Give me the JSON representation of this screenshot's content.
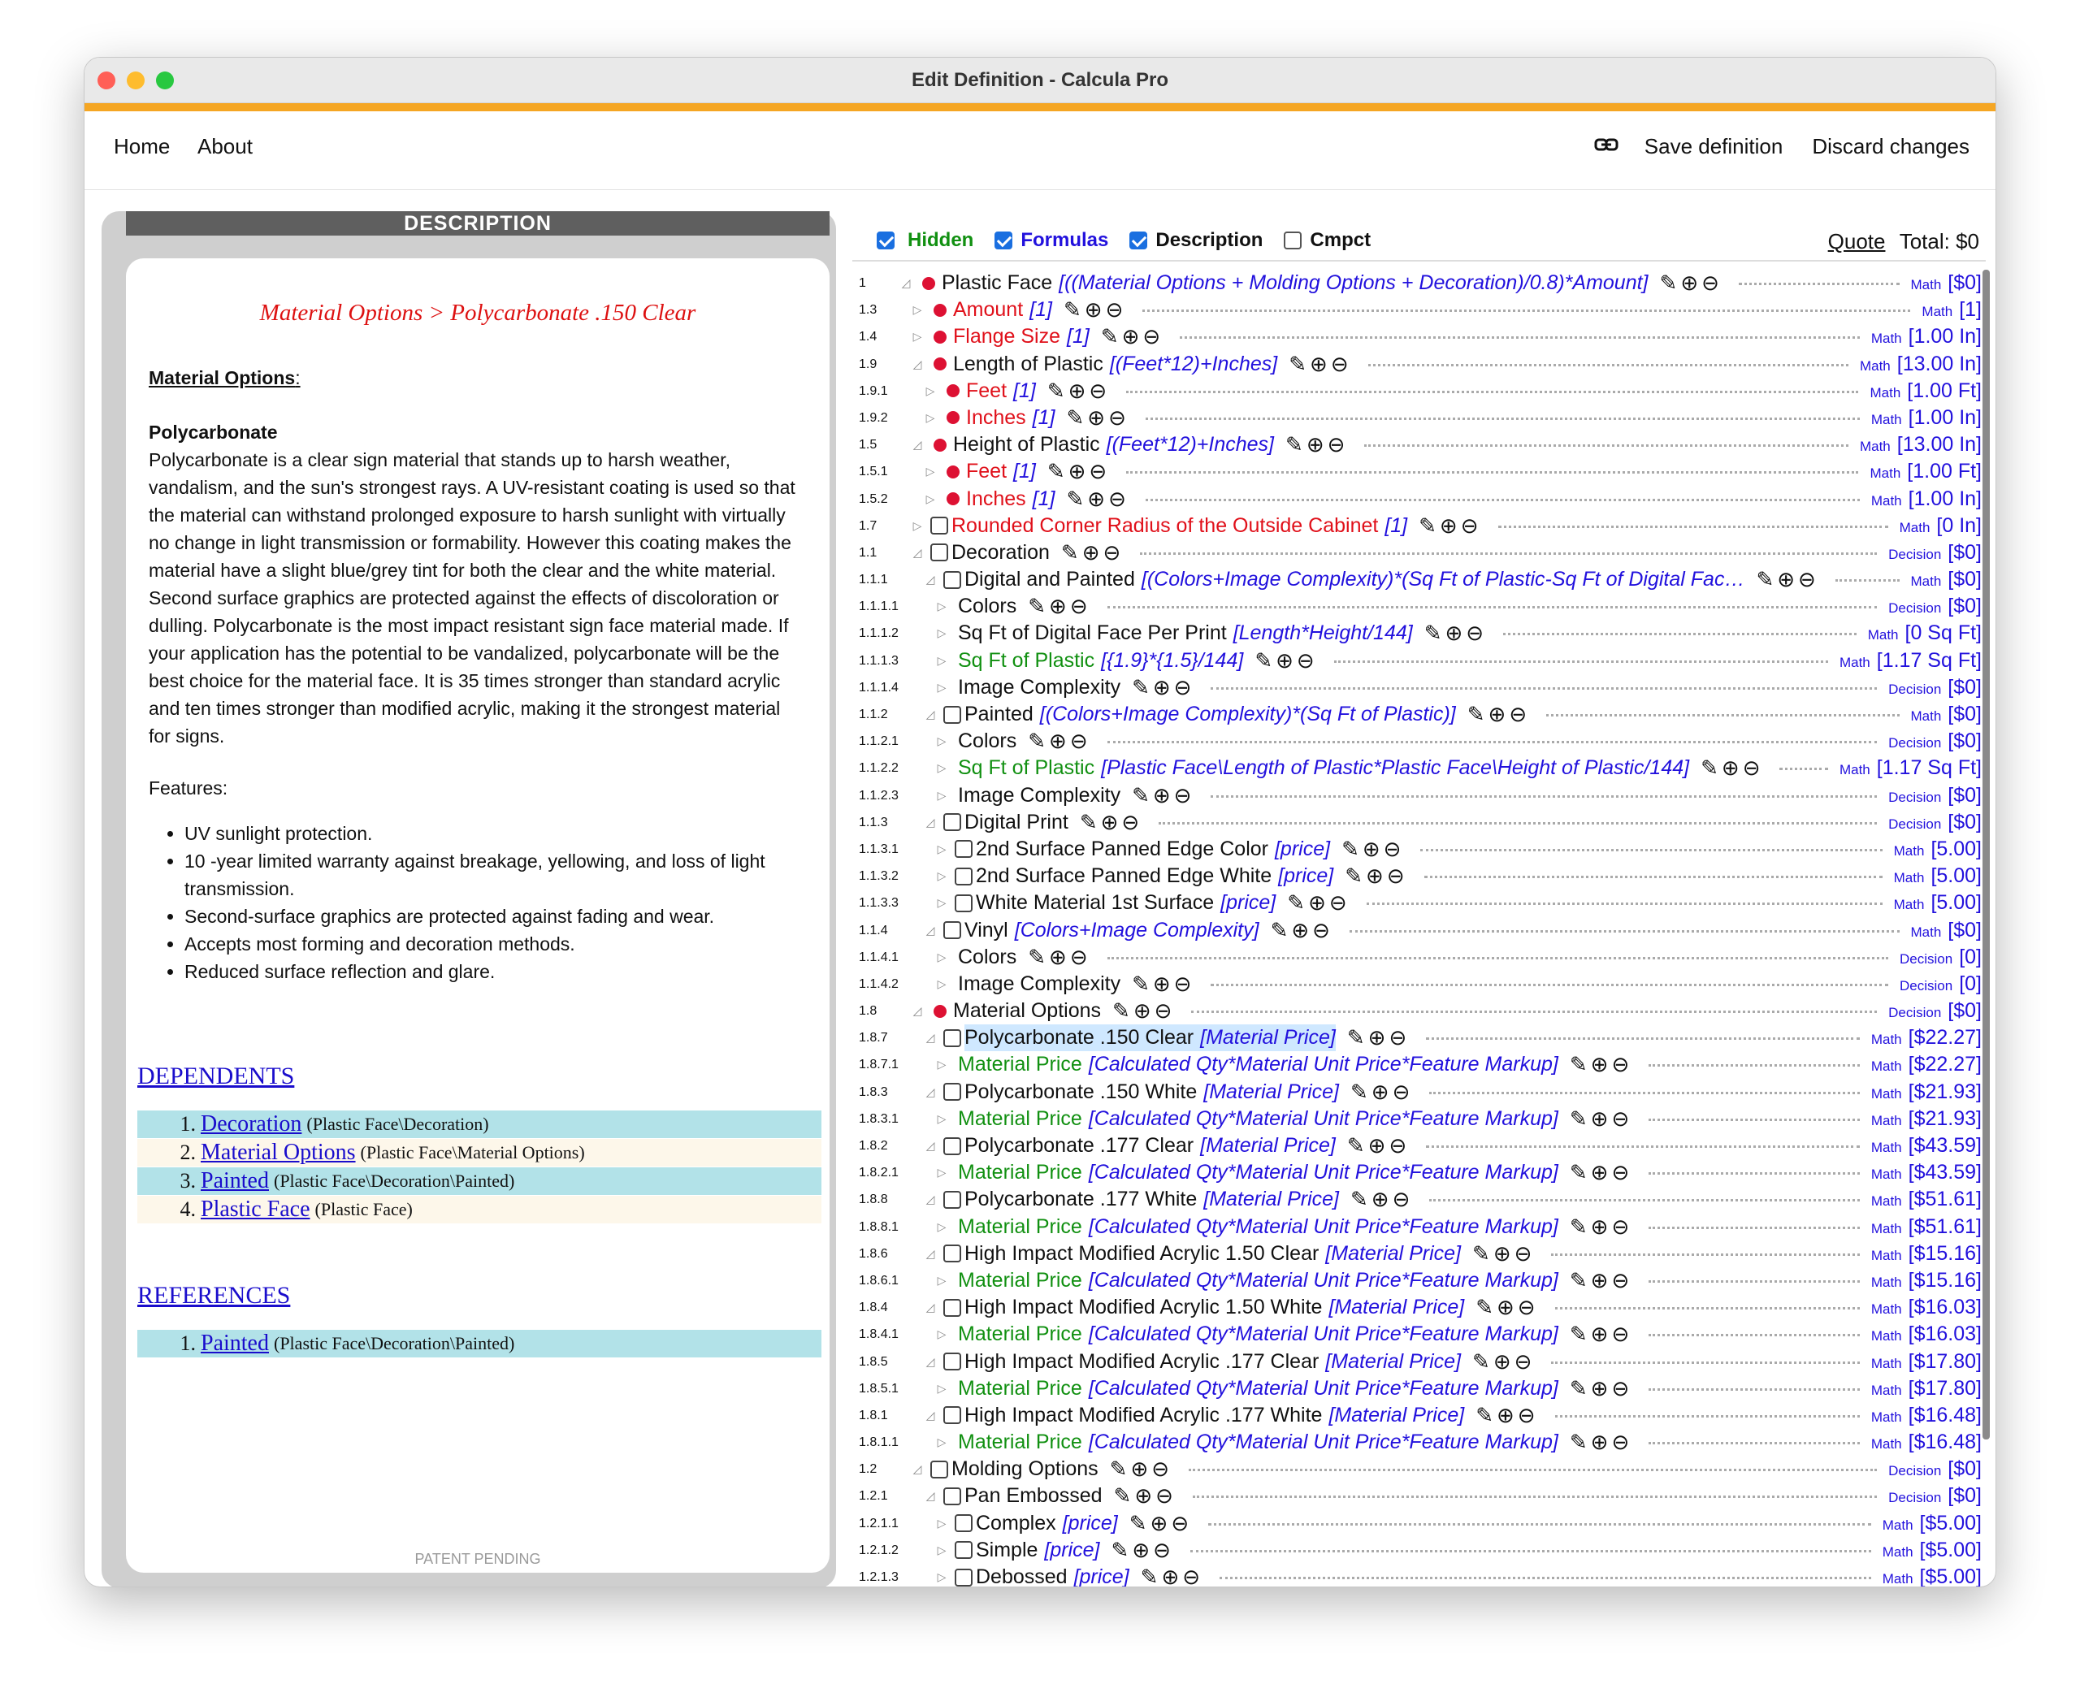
{
  "window": {
    "title": "Edit Definition - Calcula Pro"
  },
  "nav": {
    "home": "Home",
    "about": "About",
    "save": "Save definition",
    "discard": "Discard changes"
  },
  "description": {
    "header": "DESCRIPTION",
    "breadcrumb": "Material Options > Polycarbonate .150 Clear",
    "section_title": "Material Options",
    "product_name": "Polycarbonate",
    "paragraph": "Polycarbonate  is a clear sign material that stands up to harsh weather, vandalism, and the sun's strongest rays. A UV-resistant coating is used so that the material can withstand prolonged exposure to harsh sunlight with virtually no change in light transmission or formability. However this coating makes the material have a slight blue/grey tint for both the clear and the white material. Second surface graphics are protected against the effects of discoloration or dulling. Polycarbonate is the most impact resistant sign face material made. If your application has the potential to be vandalized, polycarbonate will be the best choice for the material face. It is 35 times stronger than standard acrylic and ten times stronger than modified acrylic, making it the strongest material for signs.",
    "features_label": "Features:",
    "features": [
      "UV sunlight protection.",
      "10 -year limited warranty against breakage, yellowing, and loss of light transmission.",
      "Second-surface graphics are protected against fading and wear.",
      "Accepts most forming and decoration methods.",
      "Reduced  surface reflection and glare."
    ],
    "patent": "PATENT PENDING"
  },
  "dependents": {
    "title": "DEPENDENTS",
    "items": [
      {
        "n": "1.",
        "link": "Decoration",
        "path": "(Plastic Face\\Decoration)",
        "bg": "#b2e2e8"
      },
      {
        "n": "2.",
        "link": "Material Options",
        "path": "(Plastic Face\\Material Options)",
        "bg": "#fdf7ea"
      },
      {
        "n": "3.",
        "link": "Painted",
        "path": "(Plastic Face\\Decoration\\Painted)",
        "bg": "#b2e2e8"
      },
      {
        "n": "4.",
        "link": "Plastic Face",
        "path": "(Plastic Face)",
        "bg": "#fdf7ea"
      }
    ]
  },
  "references": {
    "title": "REFERENCES",
    "items": [
      {
        "n": "1.",
        "link": "Painted",
        "path": "(Plastic Face\\Decoration\\Painted)",
        "bg": "#b2e2e8"
      }
    ]
  },
  "toolbar": {
    "hidden": "Hidden",
    "formulas": "Formulas",
    "description": "Description",
    "compact": "Cmpct",
    "quote": "Quote",
    "total": "Total: $0"
  },
  "colors": {
    "accent": "#f5a623",
    "hidden": "#119011",
    "formulas": "#2211dd",
    "red": "#e0101a",
    "green": "#119011",
    "blue": "#2211dd"
  },
  "icons": {
    "edit": "pencil-icon",
    "add": "plus-circle-icon",
    "remove": "minus-circle-icon",
    "link": "link-icon",
    "expand": "triangle-right-icon",
    "collapse": "triangle-down-icon"
  },
  "tree": [
    {
      "id": "1",
      "lvl": 0,
      "open": true,
      "mark": "bullet",
      "color": "black",
      "name": "Plastic Face",
      "fx": "[((Material Options + Molding Options + Decoration)/0.8)*Amount]",
      "type": "Math",
      "val": "[$0]"
    },
    {
      "id": "1.3",
      "lvl": 1,
      "open": false,
      "mark": "bullet",
      "color": "red",
      "name": "Amount",
      "fx": "[1]",
      "type": "Math",
      "val": "[1]"
    },
    {
      "id": "1.4",
      "lvl": 1,
      "open": false,
      "mark": "bullet",
      "color": "red",
      "name": "Flange Size",
      "fx": "[1]",
      "type": "Math",
      "val": "[1.00 In]"
    },
    {
      "id": "1.9",
      "lvl": 1,
      "open": true,
      "mark": "bullet",
      "color": "black",
      "name": "Length of Plastic",
      "fx": "[(Feet*12)+Inches]",
      "type": "Math",
      "val": "[13.00 In]"
    },
    {
      "id": "1.9.1",
      "lvl": 2,
      "open": false,
      "mark": "bullet",
      "color": "red",
      "name": "Feet",
      "fx": "[1]",
      "type": "Math",
      "val": "[1.00 Ft]"
    },
    {
      "id": "1.9.2",
      "lvl": 2,
      "open": false,
      "mark": "bullet",
      "color": "red",
      "name": "Inches",
      "fx": "[1]",
      "type": "Math",
      "val": "[1.00 In]"
    },
    {
      "id": "1.5",
      "lvl": 1,
      "open": true,
      "mark": "bullet",
      "color": "black",
      "name": "Height of Plastic",
      "fx": "[(Feet*12)+Inches]",
      "type": "Math",
      "val": "[13.00 In]"
    },
    {
      "id": "1.5.1",
      "lvl": 2,
      "open": false,
      "mark": "bullet",
      "color": "red",
      "name": "Feet",
      "fx": "[1]",
      "type": "Math",
      "val": "[1.00 Ft]"
    },
    {
      "id": "1.5.2",
      "lvl": 2,
      "open": false,
      "mark": "bullet",
      "color": "red",
      "name": "Inches",
      "fx": "[1]",
      "type": "Math",
      "val": "[1.00 In]"
    },
    {
      "id": "1.7",
      "lvl": 1,
      "open": false,
      "mark": "check",
      "color": "red",
      "name": "Rounded Corner Radius of the Outside Cabinet",
      "fx": "[1]",
      "type": "Math",
      "val": "[0 In]"
    },
    {
      "id": "1.1",
      "lvl": 1,
      "open": true,
      "mark": "check",
      "color": "black",
      "name": "Decoration",
      "fx": "",
      "type": "Decision",
      "val": "[$0]"
    },
    {
      "id": "1.1.1",
      "lvl": 2,
      "open": true,
      "mark": "check",
      "color": "black",
      "name": "Digital and Painted",
      "fx": "[(Colors+Image Complexity)*(Sq Ft of Plastic-Sq Ft of Digital Fac…",
      "type": "Math",
      "val": "[$0]"
    },
    {
      "id": "1.1.1.1",
      "lvl": 3,
      "open": false,
      "mark": "none",
      "color": "black",
      "name": "Colors",
      "fx": "",
      "type": "Decision",
      "val": "[$0]"
    },
    {
      "id": "1.1.1.2",
      "lvl": 3,
      "open": false,
      "mark": "none",
      "color": "black",
      "name": "Sq Ft of Digital Face Per Print",
      "fx": "[Length*Height/144]",
      "type": "Math",
      "val": "[0 Sq Ft]"
    },
    {
      "id": "1.1.1.3",
      "lvl": 3,
      "open": false,
      "mark": "none",
      "color": "green",
      "name": "Sq Ft of Plastic",
      "fx": "[{1.9}*{1.5}/144]",
      "type": "Math",
      "val": "[1.17 Sq Ft]"
    },
    {
      "id": "1.1.1.4",
      "lvl": 3,
      "open": false,
      "mark": "none",
      "color": "black",
      "name": "Image Complexity",
      "fx": "",
      "type": "Decision",
      "val": "[$0]"
    },
    {
      "id": "1.1.2",
      "lvl": 2,
      "open": true,
      "mark": "check",
      "color": "black",
      "name": "Painted",
      "fx": "[(Colors+Image Complexity)*(Sq Ft of Plastic)]",
      "type": "Math",
      "val": "[$0]"
    },
    {
      "id": "1.1.2.1",
      "lvl": 3,
      "open": false,
      "mark": "none",
      "color": "black",
      "name": "Colors",
      "fx": "",
      "type": "Decision",
      "val": "[$0]"
    },
    {
      "id": "1.1.2.2",
      "lvl": 3,
      "open": false,
      "mark": "none",
      "color": "green",
      "name": "Sq Ft of Plastic",
      "fx": "[Plastic Face\\Length of Plastic*Plastic Face\\Height of Plastic/144]",
      "type": "Math",
      "val": "[1.17 Sq Ft]"
    },
    {
      "id": "1.1.2.3",
      "lvl": 3,
      "open": false,
      "mark": "none",
      "color": "black",
      "name": "Image Complexity",
      "fx": "",
      "type": "Decision",
      "val": "[$0]"
    },
    {
      "id": "1.1.3",
      "lvl": 2,
      "open": true,
      "mark": "check",
      "color": "black",
      "name": "Digital Print",
      "fx": "",
      "type": "Decision",
      "val": "[$0]"
    },
    {
      "id": "1.1.3.1",
      "lvl": 3,
      "open": false,
      "mark": "check",
      "color": "black",
      "name": "2nd Surface Panned Edge Color",
      "fx": "[price]",
      "type": "Math",
      "val": "[5.00]"
    },
    {
      "id": "1.1.3.2",
      "lvl": 3,
      "open": false,
      "mark": "check",
      "color": "black",
      "name": "2nd Surface Panned Edge White",
      "fx": "[price]",
      "type": "Math",
      "val": "[5.00]"
    },
    {
      "id": "1.1.3.3",
      "lvl": 3,
      "open": false,
      "mark": "check",
      "color": "black",
      "name": "White Material 1st Surface",
      "fx": "[price]",
      "type": "Math",
      "val": "[5.00]"
    },
    {
      "id": "1.1.4",
      "lvl": 2,
      "open": true,
      "mark": "check",
      "color": "black",
      "name": "Vinyl",
      "fx": "[Colors+Image Complexity]",
      "type": "Math",
      "val": "[$0]"
    },
    {
      "id": "1.1.4.1",
      "lvl": 3,
      "open": false,
      "mark": "none",
      "color": "black",
      "name": "Colors",
      "fx": "",
      "type": "Decision",
      "val": "[0]"
    },
    {
      "id": "1.1.4.2",
      "lvl": 3,
      "open": false,
      "mark": "none",
      "color": "black",
      "name": "Image Complexity",
      "fx": "",
      "type": "Decision",
      "val": "[0]"
    },
    {
      "id": "1.8",
      "lvl": 1,
      "open": true,
      "mark": "bullet",
      "color": "black",
      "name": "Material Options",
      "fx": "",
      "type": "Decision",
      "val": "[$0]"
    },
    {
      "id": "1.8.7",
      "lvl": 2,
      "open": true,
      "mark": "check",
      "color": "black",
      "name": "Polycarbonate .150 Clear",
      "fx": "[Material Price]",
      "type": "Math",
      "val": "[$22.27]",
      "hl": true
    },
    {
      "id": "1.8.7.1",
      "lvl": 3,
      "open": false,
      "mark": "none",
      "color": "green",
      "name": "Material Price",
      "fx": "[Calculated Qty*Material Unit Price*Feature Markup]",
      "type": "Math",
      "val": "[$22.27]"
    },
    {
      "id": "1.8.3",
      "lvl": 2,
      "open": true,
      "mark": "check",
      "color": "black",
      "name": "Polycarbonate .150 White",
      "fx": "[Material Price]",
      "type": "Math",
      "val": "[$21.93]"
    },
    {
      "id": "1.8.3.1",
      "lvl": 3,
      "open": false,
      "mark": "none",
      "color": "green",
      "name": "Material Price",
      "fx": "[Calculated Qty*Material Unit Price*Feature Markup]",
      "type": "Math",
      "val": "[$21.93]"
    },
    {
      "id": "1.8.2",
      "lvl": 2,
      "open": true,
      "mark": "check",
      "color": "black",
      "name": "Polycarbonate .177 Clear",
      "fx": "[Material Price]",
      "type": "Math",
      "val": "[$43.59]"
    },
    {
      "id": "1.8.2.1",
      "lvl": 3,
      "open": false,
      "mark": "none",
      "color": "green",
      "name": "Material Price",
      "fx": "[Calculated Qty*Material Unit Price*Feature Markup]",
      "type": "Math",
      "val": "[$43.59]"
    },
    {
      "id": "1.8.8",
      "lvl": 2,
      "open": true,
      "mark": "check",
      "color": "black",
      "name": "Polycarbonate .177 White",
      "fx": "[Material Price]",
      "type": "Math",
      "val": "[$51.61]"
    },
    {
      "id": "1.8.8.1",
      "lvl": 3,
      "open": false,
      "mark": "none",
      "color": "green",
      "name": "Material Price",
      "fx": "[Calculated Qty*Material Unit Price*Feature Markup]",
      "type": "Math",
      "val": "[$51.61]"
    },
    {
      "id": "1.8.6",
      "lvl": 2,
      "open": true,
      "mark": "check",
      "color": "black",
      "name": "High Impact Modified Acrylic 1.50 Clear",
      "fx": "[Material Price]",
      "type": "Math",
      "val": "[$15.16]"
    },
    {
      "id": "1.8.6.1",
      "lvl": 3,
      "open": false,
      "mark": "none",
      "color": "green",
      "name": "Material Price",
      "fx": "[Calculated Qty*Material Unit Price*Feature Markup]",
      "type": "Math",
      "val": "[$15.16]"
    },
    {
      "id": "1.8.4",
      "lvl": 2,
      "open": true,
      "mark": "check",
      "color": "black",
      "name": "High Impact Modified Acrylic 1.50 White",
      "fx": "[Material Price]",
      "type": "Math",
      "val": "[$16.03]"
    },
    {
      "id": "1.8.4.1",
      "lvl": 3,
      "open": false,
      "mark": "none",
      "color": "green",
      "name": "Material Price",
      "fx": "[Calculated Qty*Material Unit Price*Feature Markup]",
      "type": "Math",
      "val": "[$16.03]"
    },
    {
      "id": "1.8.5",
      "lvl": 2,
      "open": true,
      "mark": "check",
      "color": "black",
      "name": "High Impact Modified Acrylic .177 Clear",
      "fx": "[Material Price]",
      "type": "Math",
      "val": "[$17.80]"
    },
    {
      "id": "1.8.5.1",
      "lvl": 3,
      "open": false,
      "mark": "none",
      "color": "green",
      "name": "Material Price",
      "fx": "[Calculated Qty*Material Unit Price*Feature Markup]",
      "type": "Math",
      "val": "[$17.80]"
    },
    {
      "id": "1.8.1",
      "lvl": 2,
      "open": true,
      "mark": "check",
      "color": "black",
      "name": "High Impact Modified Acrylic .177 White",
      "fx": "[Material Price]",
      "type": "Math",
      "val": "[$16.48]"
    },
    {
      "id": "1.8.1.1",
      "lvl": 3,
      "open": false,
      "mark": "none",
      "color": "green",
      "name": "Material Price",
      "fx": "[Calculated Qty*Material Unit Price*Feature Markup]",
      "type": "Math",
      "val": "[$16.48]"
    },
    {
      "id": "1.2",
      "lvl": 1,
      "open": true,
      "mark": "check",
      "color": "black",
      "name": "Molding Options",
      "fx": "",
      "type": "Decision",
      "val": "[$0]"
    },
    {
      "id": "1.2.1",
      "lvl": 2,
      "open": true,
      "mark": "check",
      "color": "black",
      "name": "Pan Embossed",
      "fx": "",
      "type": "Decision",
      "val": "[$0]"
    },
    {
      "id": "1.2.1.1",
      "lvl": 3,
      "open": false,
      "mark": "check",
      "color": "black",
      "name": "Complex",
      "fx": "[price]",
      "type": "Math",
      "val": "[$5.00]"
    },
    {
      "id": "1.2.1.2",
      "lvl": 3,
      "open": false,
      "mark": "check",
      "color": "black",
      "name": "Simple",
      "fx": "[price]",
      "type": "Math",
      "val": "[$5.00]"
    },
    {
      "id": "1.2.1.3",
      "lvl": 3,
      "open": false,
      "mark": "check",
      "color": "black",
      "name": "Debossed",
      "fx": "[price]",
      "type": "Math",
      "val": "[$5.00]"
    }
  ]
}
